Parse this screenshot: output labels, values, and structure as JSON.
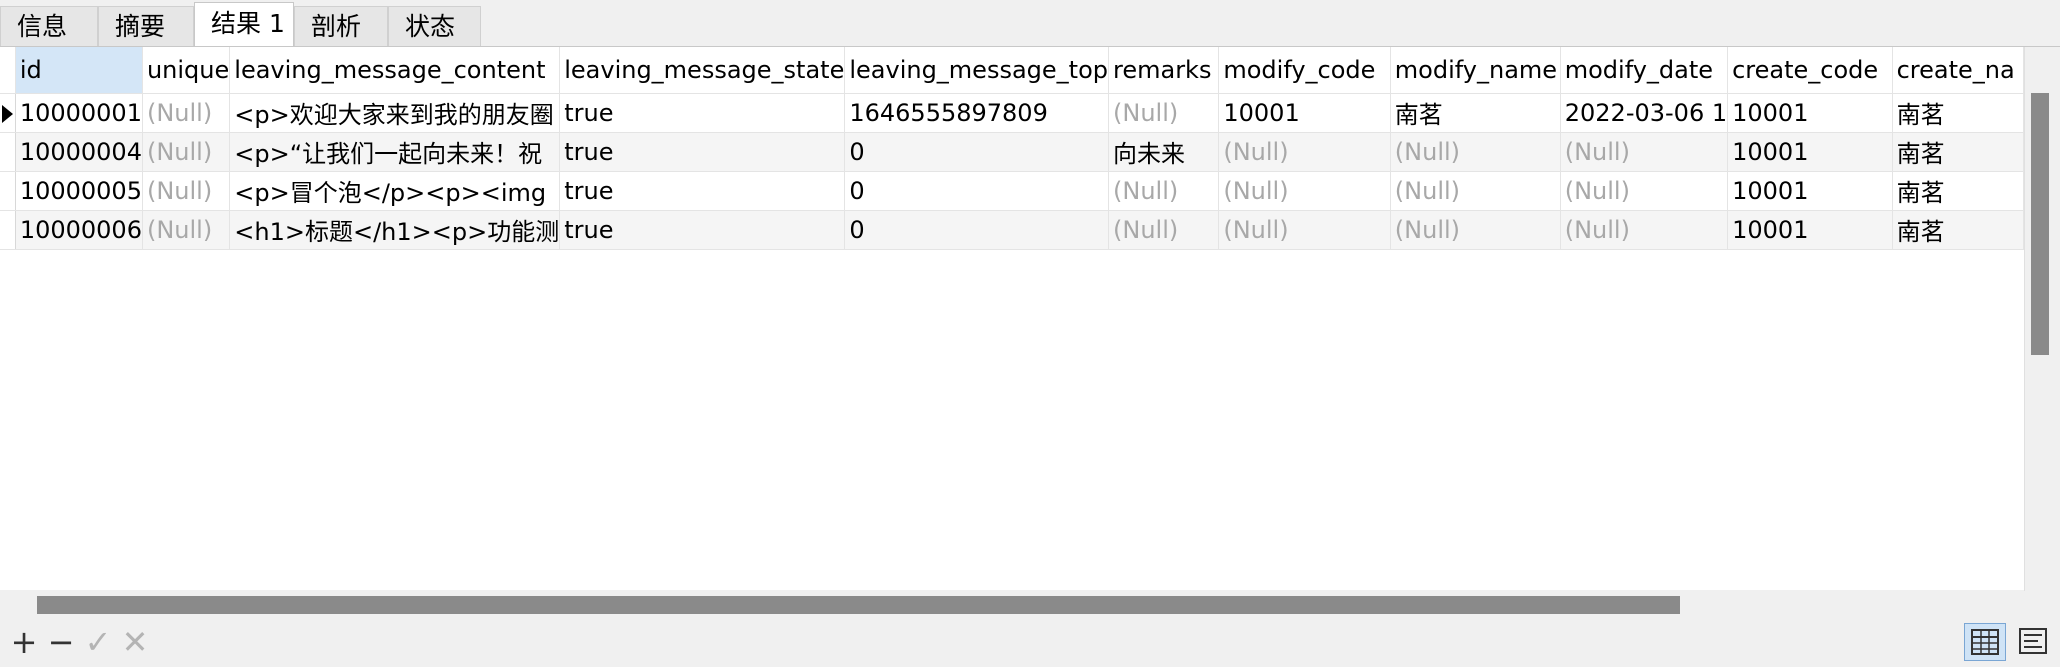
{
  "tabs": [
    {
      "label": "信息"
    },
    {
      "label": "摘要"
    },
    {
      "label": "结果 1"
    },
    {
      "label": "剖析"
    },
    {
      "label": "状态"
    }
  ],
  "active_tab": "结果 1",
  "grid": {
    "columns": [
      "id",
      "unique",
      "leaving_message_content",
      "leaving_message_state",
      "leaving_message_top",
      "remarks",
      "modify_code",
      "modify_name",
      "modify_date",
      "create_code",
      "create_na"
    ],
    "rows": [
      [
        "10000001",
        "(Null)",
        "<p>欢迎大家来到我的朋友圈",
        "true",
        "1646555897809",
        "(Null)",
        "10001",
        "南茗",
        "2022-03-06 1",
        "10001",
        "南茗"
      ],
      [
        "10000004",
        "(Null)",
        "<p>“让我们一起向未来！祝",
        "true",
        "0",
        "向未来",
        "(Null)",
        "(Null)",
        "(Null)",
        "10001",
        "南茗"
      ],
      [
        "10000005",
        "(Null)",
        "<p>冒个泡</p><p><img",
        "true",
        "0",
        "(Null)",
        "(Null)",
        "(Null)",
        "(Null)",
        "10001",
        "南茗"
      ],
      [
        "10000006",
        "(Null)",
        "<h1>标题</h1><p>功能测",
        "true",
        "0",
        "(Null)",
        "(Null)",
        "(Null)",
        "(Null)",
        "10001",
        "南茗"
      ]
    ],
    "selected_row": 0
  },
  "toolbar": {
    "add_label": "+",
    "delete_label": "−",
    "apply_label": "✓",
    "cancel_label": "✕"
  },
  "icons": {
    "add": "plus-icon",
    "delete": "minus-icon",
    "apply": "check-icon",
    "cancel": "close-icon",
    "grid_view": "grid-view-icon",
    "form_view": "form-view-icon"
  },
  "colors": {
    "selected_header": "#d4e6f7",
    "null_text": "#a8a8a8",
    "scrollbar_thumb": "#8a8a8a"
  }
}
